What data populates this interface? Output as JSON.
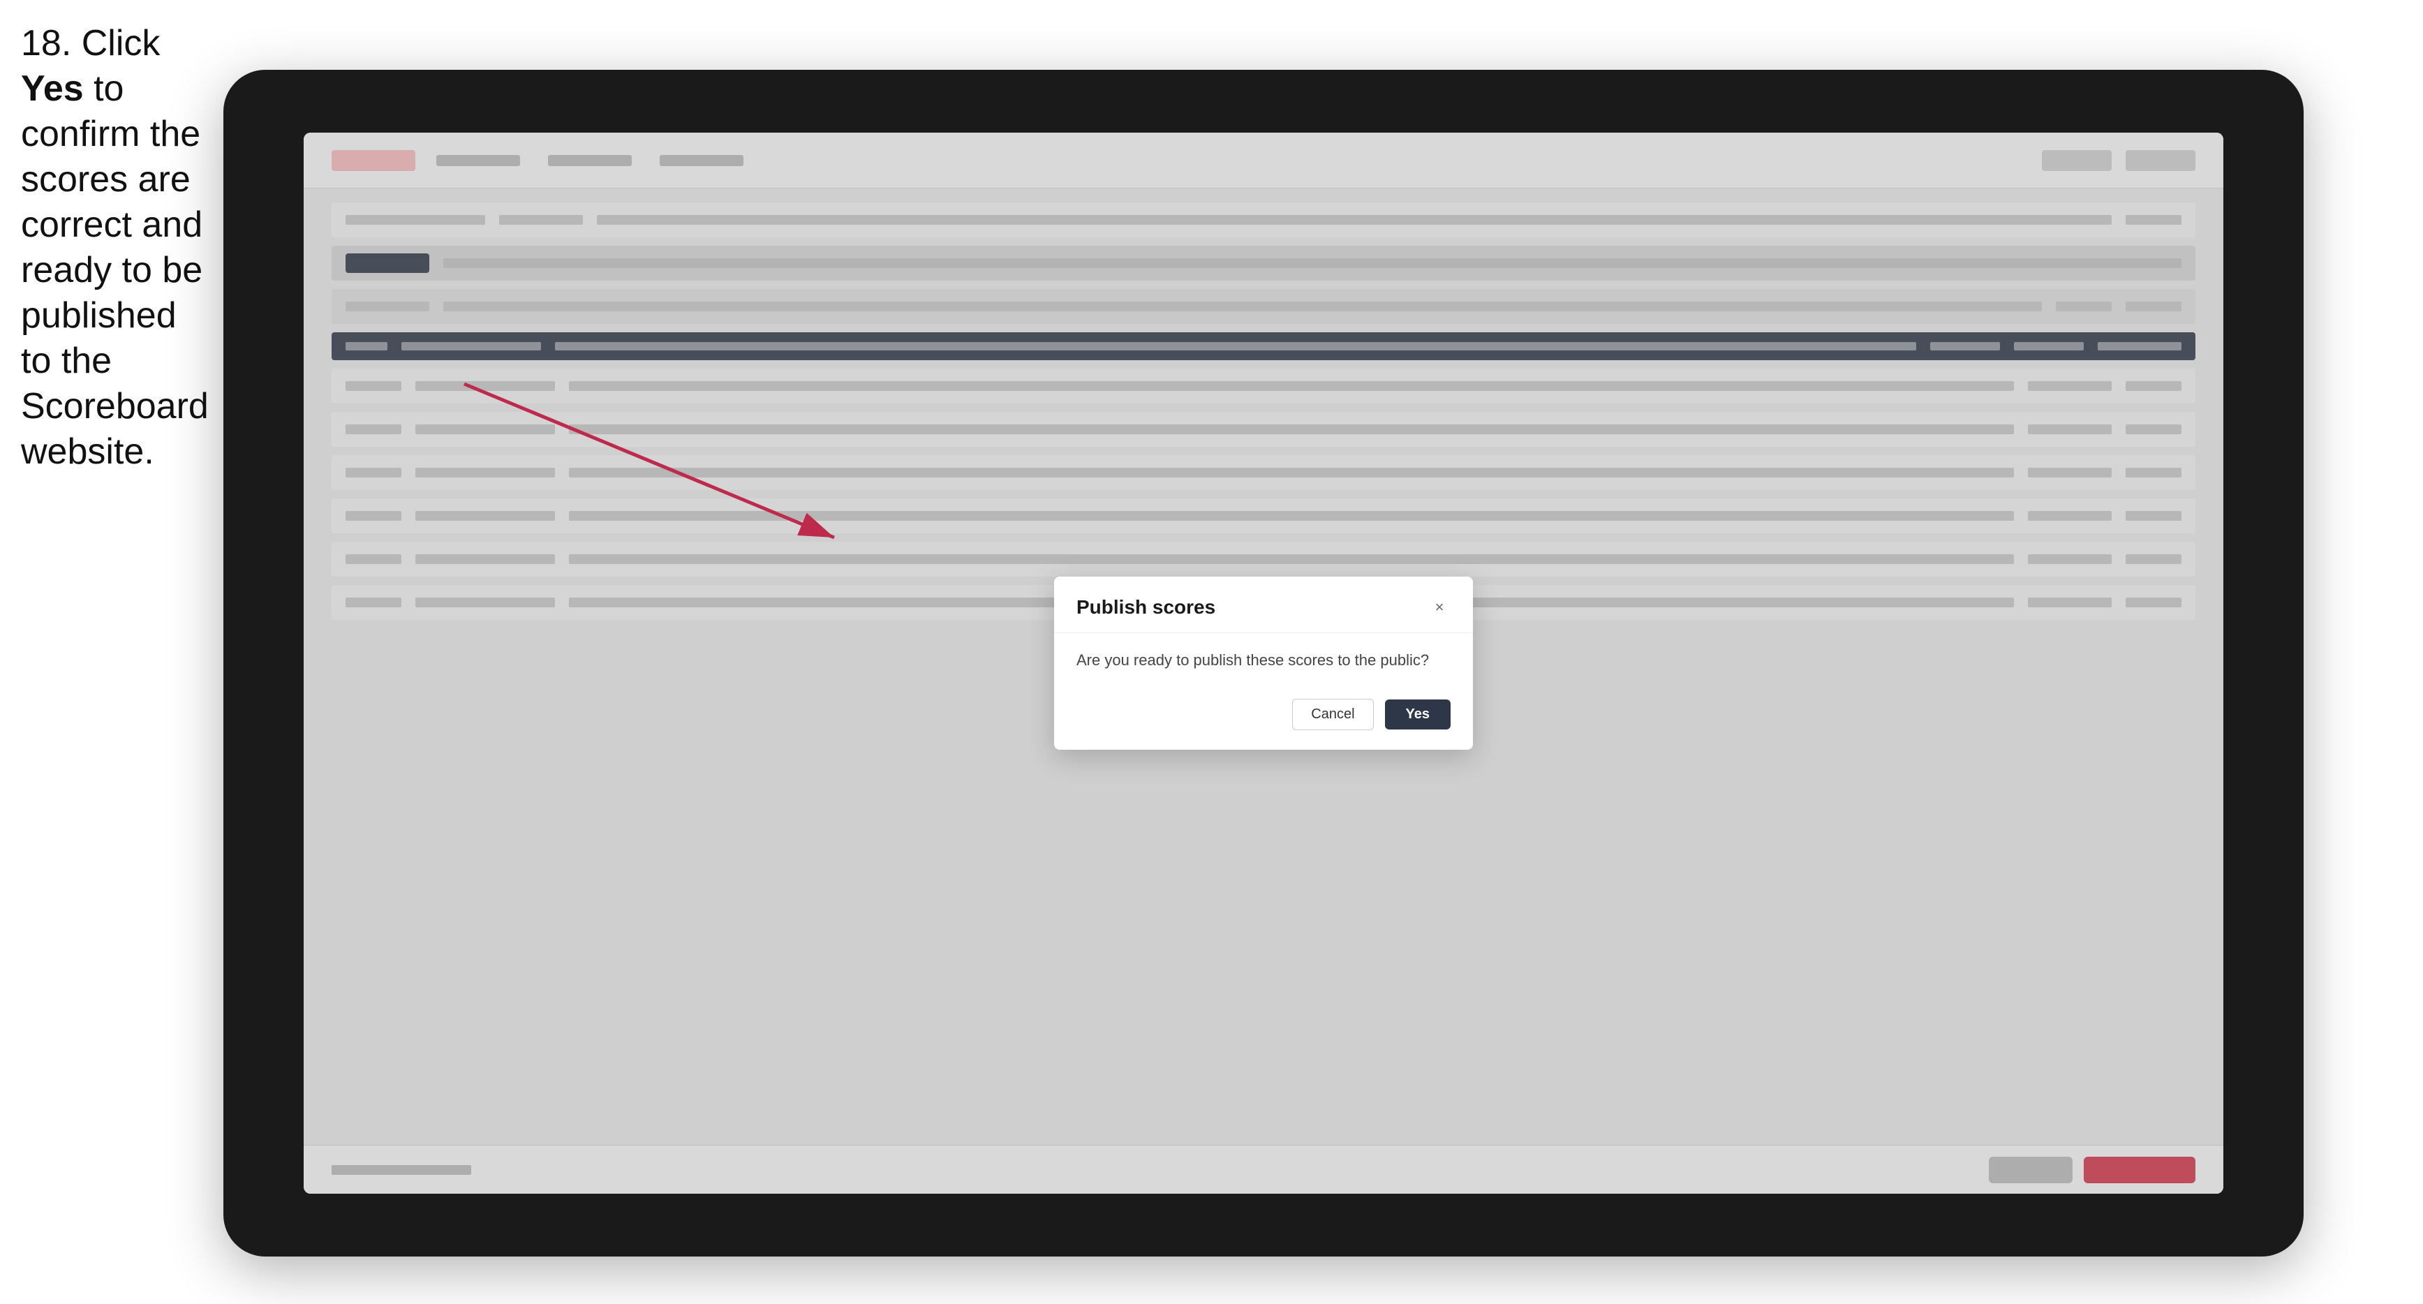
{
  "instruction": {
    "step_number": "18.",
    "text_part1": " Click ",
    "text_bold": "Yes",
    "text_part2": " to confirm the scores are correct and ready to be published to the Scoreboard website."
  },
  "modal": {
    "title": "Publish scores",
    "message": "Are you ready to publish these scores to the public?",
    "cancel_label": "Cancel",
    "yes_label": "Yes",
    "close_icon": "×"
  },
  "buttons": {
    "cancel": "Cancel",
    "yes": "Yes"
  },
  "colors": {
    "yes_btn_bg": "#2d3748",
    "arrow_color": "#e0325a"
  }
}
